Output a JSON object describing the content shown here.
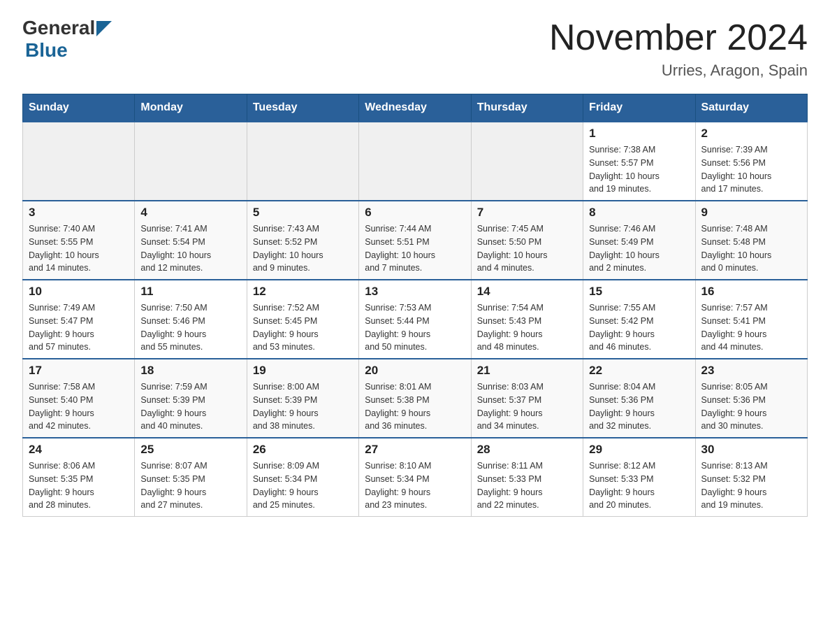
{
  "header": {
    "logo_general": "General",
    "logo_blue": "Blue",
    "main_title": "November 2024",
    "subtitle": "Urries, Aragon, Spain"
  },
  "calendar": {
    "days_of_week": [
      "Sunday",
      "Monday",
      "Tuesday",
      "Wednesday",
      "Thursday",
      "Friday",
      "Saturday"
    ],
    "weeks": [
      {
        "days": [
          {
            "number": "",
            "info": ""
          },
          {
            "number": "",
            "info": ""
          },
          {
            "number": "",
            "info": ""
          },
          {
            "number": "",
            "info": ""
          },
          {
            "number": "",
            "info": ""
          },
          {
            "number": "1",
            "info": "Sunrise: 7:38 AM\nSunset: 5:57 PM\nDaylight: 10 hours\nand 19 minutes."
          },
          {
            "number": "2",
            "info": "Sunrise: 7:39 AM\nSunset: 5:56 PM\nDaylight: 10 hours\nand 17 minutes."
          }
        ]
      },
      {
        "days": [
          {
            "number": "3",
            "info": "Sunrise: 7:40 AM\nSunset: 5:55 PM\nDaylight: 10 hours\nand 14 minutes."
          },
          {
            "number": "4",
            "info": "Sunrise: 7:41 AM\nSunset: 5:54 PM\nDaylight: 10 hours\nand 12 minutes."
          },
          {
            "number": "5",
            "info": "Sunrise: 7:43 AM\nSunset: 5:52 PM\nDaylight: 10 hours\nand 9 minutes."
          },
          {
            "number": "6",
            "info": "Sunrise: 7:44 AM\nSunset: 5:51 PM\nDaylight: 10 hours\nand 7 minutes."
          },
          {
            "number": "7",
            "info": "Sunrise: 7:45 AM\nSunset: 5:50 PM\nDaylight: 10 hours\nand 4 minutes."
          },
          {
            "number": "8",
            "info": "Sunrise: 7:46 AM\nSunset: 5:49 PM\nDaylight: 10 hours\nand 2 minutes."
          },
          {
            "number": "9",
            "info": "Sunrise: 7:48 AM\nSunset: 5:48 PM\nDaylight: 10 hours\nand 0 minutes."
          }
        ]
      },
      {
        "days": [
          {
            "number": "10",
            "info": "Sunrise: 7:49 AM\nSunset: 5:47 PM\nDaylight: 9 hours\nand 57 minutes."
          },
          {
            "number": "11",
            "info": "Sunrise: 7:50 AM\nSunset: 5:46 PM\nDaylight: 9 hours\nand 55 minutes."
          },
          {
            "number": "12",
            "info": "Sunrise: 7:52 AM\nSunset: 5:45 PM\nDaylight: 9 hours\nand 53 minutes."
          },
          {
            "number": "13",
            "info": "Sunrise: 7:53 AM\nSunset: 5:44 PM\nDaylight: 9 hours\nand 50 minutes."
          },
          {
            "number": "14",
            "info": "Sunrise: 7:54 AM\nSunset: 5:43 PM\nDaylight: 9 hours\nand 48 minutes."
          },
          {
            "number": "15",
            "info": "Sunrise: 7:55 AM\nSunset: 5:42 PM\nDaylight: 9 hours\nand 46 minutes."
          },
          {
            "number": "16",
            "info": "Sunrise: 7:57 AM\nSunset: 5:41 PM\nDaylight: 9 hours\nand 44 minutes."
          }
        ]
      },
      {
        "days": [
          {
            "number": "17",
            "info": "Sunrise: 7:58 AM\nSunset: 5:40 PM\nDaylight: 9 hours\nand 42 minutes."
          },
          {
            "number": "18",
            "info": "Sunrise: 7:59 AM\nSunset: 5:39 PM\nDaylight: 9 hours\nand 40 minutes."
          },
          {
            "number": "19",
            "info": "Sunrise: 8:00 AM\nSunset: 5:39 PM\nDaylight: 9 hours\nand 38 minutes."
          },
          {
            "number": "20",
            "info": "Sunrise: 8:01 AM\nSunset: 5:38 PM\nDaylight: 9 hours\nand 36 minutes."
          },
          {
            "number": "21",
            "info": "Sunrise: 8:03 AM\nSunset: 5:37 PM\nDaylight: 9 hours\nand 34 minutes."
          },
          {
            "number": "22",
            "info": "Sunrise: 8:04 AM\nSunset: 5:36 PM\nDaylight: 9 hours\nand 32 minutes."
          },
          {
            "number": "23",
            "info": "Sunrise: 8:05 AM\nSunset: 5:36 PM\nDaylight: 9 hours\nand 30 minutes."
          }
        ]
      },
      {
        "days": [
          {
            "number": "24",
            "info": "Sunrise: 8:06 AM\nSunset: 5:35 PM\nDaylight: 9 hours\nand 28 minutes."
          },
          {
            "number": "25",
            "info": "Sunrise: 8:07 AM\nSunset: 5:35 PM\nDaylight: 9 hours\nand 27 minutes."
          },
          {
            "number": "26",
            "info": "Sunrise: 8:09 AM\nSunset: 5:34 PM\nDaylight: 9 hours\nand 25 minutes."
          },
          {
            "number": "27",
            "info": "Sunrise: 8:10 AM\nSunset: 5:34 PM\nDaylight: 9 hours\nand 23 minutes."
          },
          {
            "number": "28",
            "info": "Sunrise: 8:11 AM\nSunset: 5:33 PM\nDaylight: 9 hours\nand 22 minutes."
          },
          {
            "number": "29",
            "info": "Sunrise: 8:12 AM\nSunset: 5:33 PM\nDaylight: 9 hours\nand 20 minutes."
          },
          {
            "number": "30",
            "info": "Sunrise: 8:13 AM\nSunset: 5:32 PM\nDaylight: 9 hours\nand 19 minutes."
          }
        ]
      }
    ]
  }
}
